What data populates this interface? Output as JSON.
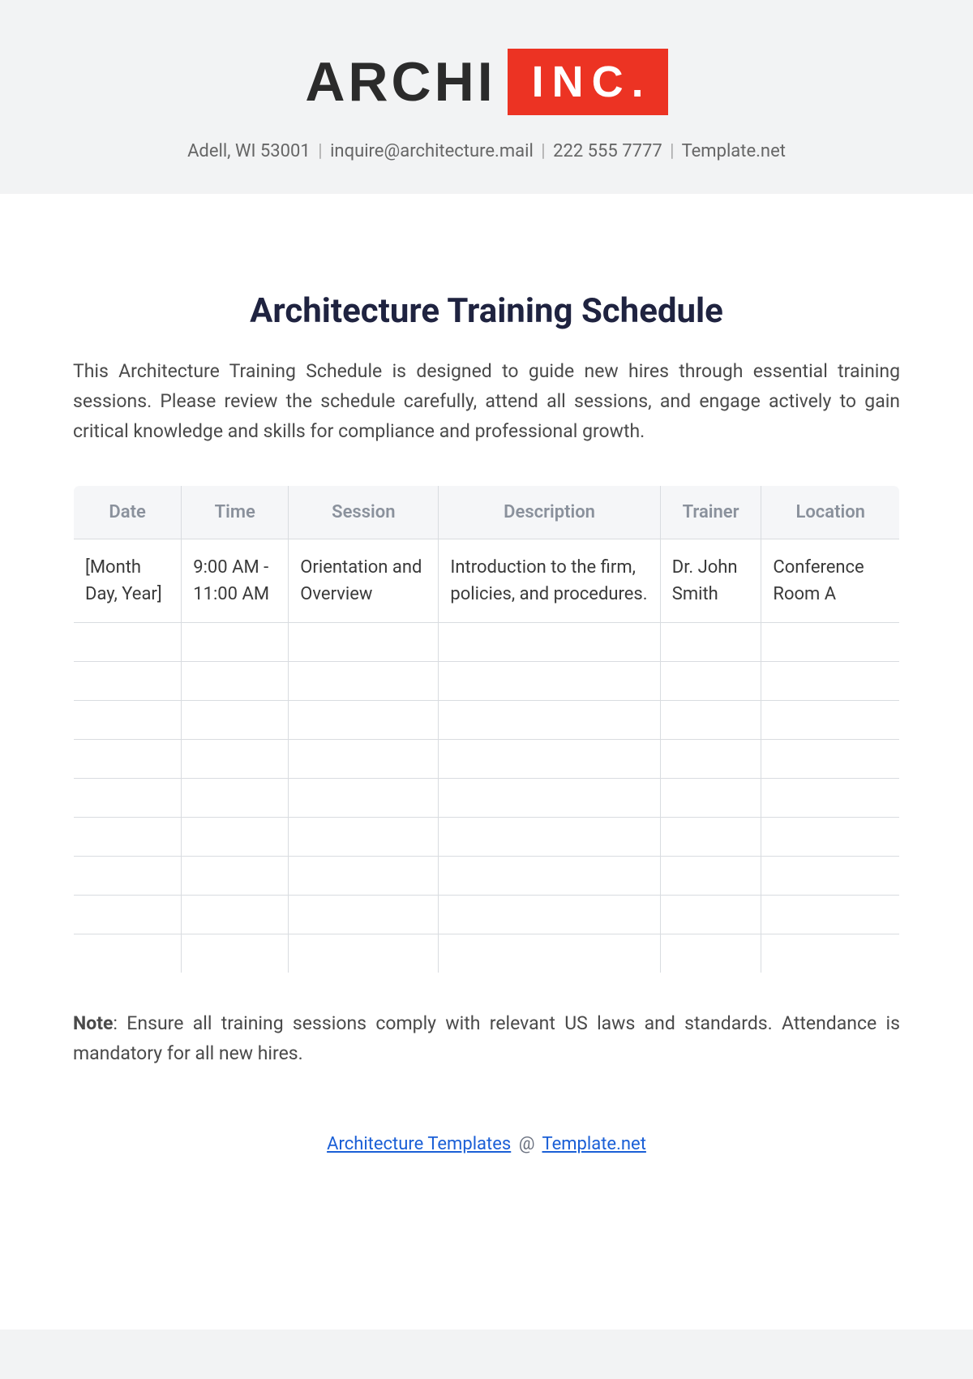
{
  "logo": {
    "part1": "ARCHI",
    "part2": "INC."
  },
  "contact": {
    "address": "Adell, WI 53001",
    "email": "inquire@architecture.mail",
    "phone": "222 555 7777",
    "site": "Template.net"
  },
  "title": "Architecture Training Schedule",
  "intro": "This Architecture Training Schedule is designed to guide new hires through essential training sessions. Please review the schedule carefully, attend all sessions, and engage actively to gain critical knowledge and skills for compliance and professional growth.",
  "columns": [
    "Date",
    "Time",
    "Session",
    "Description",
    "Trainer",
    "Location"
  ],
  "rows": [
    {
      "date": "[Month Day, Year]",
      "time": "9:00 AM - 11:00 AM",
      "session": "Orientation and Overview",
      "description": "Introduction to the firm, policies, and procedures.",
      "trainer": "Dr. John Smith",
      "location": "Conference Room A"
    }
  ],
  "emptyRowCount": 9,
  "note": {
    "label": "Note",
    "text": ": Ensure all training sessions comply with relevant US laws and standards. Attendance is mandatory for all new hires."
  },
  "footer": {
    "link1": "Architecture Templates",
    "at": "@",
    "link2": "Template.net"
  }
}
